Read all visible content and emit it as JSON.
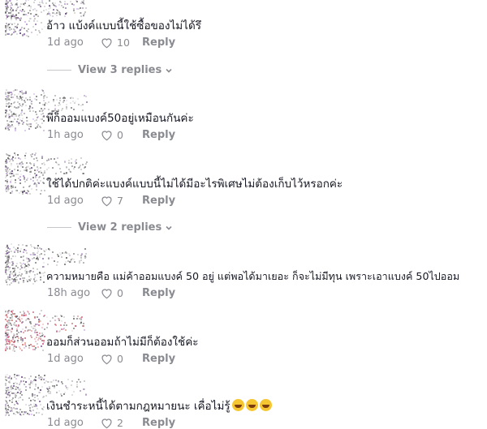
{
  "comments": [
    {
      "text": "อ้าว แบ้งค์แบบนี้ใช้ซื้อของไม่ได้รึ",
      "time": "1d ago",
      "likes": "10",
      "reply": "Reply"
    },
    {
      "text": "พี่ก็ออมแบงค์50อยู่เหมือนกันค่ะ",
      "time": "1h ago",
      "likes": "0",
      "reply": "Reply"
    },
    {
      "text": "ใช้ได้ปกติค่ะแบงค์แบบนี้ไม่ได้มีอะไรพิเศษไม่ต้องเก็บไว้หรอกค่ะ",
      "time": "1d ago",
      "likes": "7",
      "reply": "Reply"
    },
    {
      "text": "ความหมายคือ แม่ค้าออมแบงค์ 50 อยู่ แต่พอได้มาเยอะ ก็จะไม่มีทุน เพราะเอาแบงค์ 50ไปออม",
      "time": "18h ago",
      "likes": "0",
      "reply": "Reply"
    },
    {
      "text": "ออมก็ส่วนออมถ้าไม่มีก็ต้องใช้ค่ะ",
      "time": "1d ago",
      "likes": "0",
      "reply": "Reply"
    },
    {
      "text": "เงินชำระหนี้ได้ตามกฎหมายนะ เคื่อไม่รู้",
      "time": "1d ago",
      "likes": "2",
      "reply": "Reply",
      "emoji_count": 3
    }
  ],
  "view_replies": [
    {
      "label": "View 3 replies"
    },
    {
      "label": "View 2 replies"
    }
  ],
  "colors": {
    "text": "#161823",
    "muted": "#8a8b91",
    "accent": "#f6c632"
  },
  "icons": {
    "like": "heart-outline-icon",
    "expand": "chevron-down-icon",
    "emoji": "laughing-emoji-icon"
  }
}
